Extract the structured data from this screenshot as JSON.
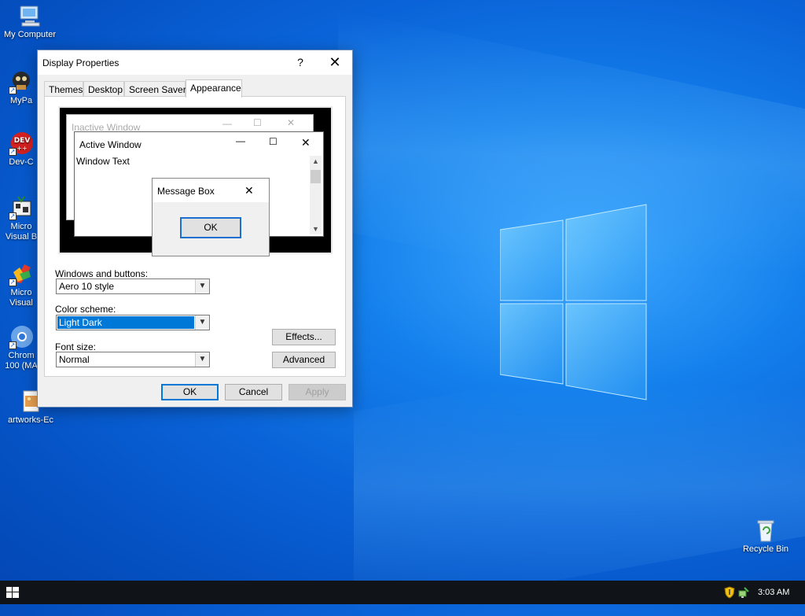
{
  "desktop": {
    "icons": [
      {
        "label": "My Computer",
        "icon": "computer-icon"
      },
      {
        "label": "MyPa",
        "icon": "mypa-app-icon"
      },
      {
        "label": "Dev-C",
        "icon": "dev-cpp-icon"
      },
      {
        "label": "Micro\nVisual B",
        "icon": "visual-basic-icon"
      },
      {
        "label": "Micro\nVisual",
        "icon": "visual-studio-icon"
      },
      {
        "label": "Chrom\n100 (MA",
        "icon": "chromium-icon"
      },
      {
        "label": "artworks-Ec",
        "icon": "image-file-icon"
      },
      {
        "label": "Recycle Bin",
        "icon": "recycle-bin-icon"
      }
    ]
  },
  "dialog": {
    "title": "Display Properties",
    "help_glyph": "?",
    "close_glyph": "✕",
    "tabs": [
      {
        "label": "Themes"
      },
      {
        "label": "Desktop"
      },
      {
        "label": "Screen Saver"
      },
      {
        "label": "Appearance",
        "active": true
      }
    ],
    "preview": {
      "inactive_title": "Inactive Window",
      "active_title": "Active Window",
      "window_text": "Window Text",
      "message_title": "Message Box",
      "ok_label": "OK"
    },
    "windows_buttons_label": "Windows and buttons:",
    "windows_buttons_value": "Aero 10 style",
    "color_scheme_label": "Color scheme:",
    "color_scheme_value": "Light Dark",
    "font_size_label": "Font size:",
    "font_size_value": "Normal",
    "effects_label": "Effects...",
    "advanced_label": "Advanced",
    "ok_label": "OK",
    "cancel_label": "Cancel",
    "apply_label": "Apply"
  },
  "taskbar": {
    "clock": "3:03 AM"
  },
  "colors": {
    "accent": "#0078d7",
    "taskbar": "#101418"
  }
}
